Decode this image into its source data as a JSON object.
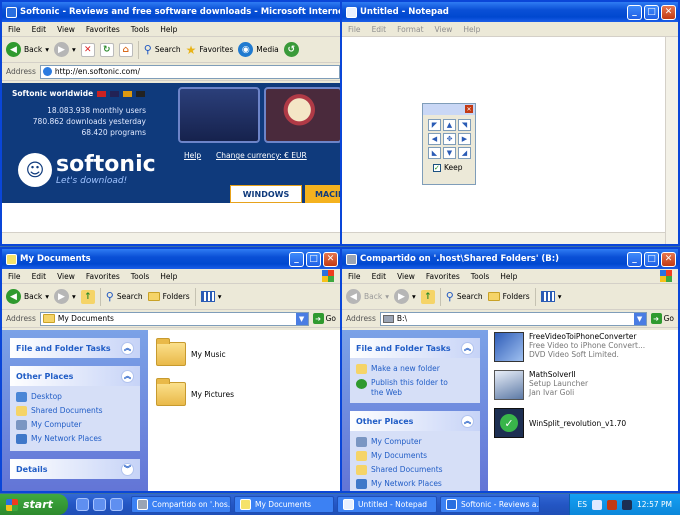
{
  "ie": {
    "title": "Softonic - Reviews and free software downloads - Microsoft Internet Explorer",
    "menu": [
      "File",
      "Edit",
      "View",
      "Favorites",
      "Tools",
      "Help"
    ],
    "toolbar": {
      "back": "Back",
      "search": "Search",
      "favorites": "Favorites",
      "media": "Media"
    },
    "address_label": "Address",
    "address_value": "http://en.softonic.com/",
    "worldwide": "Softonic worldwide",
    "stats": [
      "18.083.938 monthly users",
      "780.862 downloads yesterday",
      "68.420 programs"
    ],
    "logo_text": "softonic",
    "tagline": "Let's download!",
    "help_link": "Help",
    "currency_link": "Change currency: € EUR",
    "tabs": [
      "WINDOWS",
      "MACIN"
    ]
  },
  "notepad": {
    "title": "Untitled - Notepad",
    "menu": [
      "File",
      "Edit",
      "Format",
      "View",
      "Help"
    ],
    "keep_label": "Keep"
  },
  "mydocs": {
    "title": "My Documents",
    "menu": [
      "File",
      "Edit",
      "View",
      "Favorites",
      "Tools",
      "Help"
    ],
    "toolbar": {
      "back": "Back",
      "search": "Search",
      "folders": "Folders"
    },
    "address_label": "Address",
    "address_value": "My Documents",
    "go": "Go",
    "tasks_header": "File and Folder Tasks",
    "other_header": "Other Places",
    "other_items": [
      "Desktop",
      "Shared Documents",
      "My Computer",
      "My Network Places"
    ],
    "details_header": "Details",
    "files": [
      "My Music",
      "My Pictures"
    ]
  },
  "shared": {
    "title": "Compartido on '.host\\Shared Folders' (B:)",
    "menu": [
      "File",
      "Edit",
      "View",
      "Favorites",
      "Tools",
      "Help"
    ],
    "toolbar": {
      "back": "Back",
      "search": "Search",
      "folders": "Folders"
    },
    "address_label": "Address",
    "address_value": "B:\\",
    "go": "Go",
    "tasks_header": "File and Folder Tasks",
    "tasks_items": [
      "Make a new folder",
      "Publish this folder to the Web"
    ],
    "other_header": "Other Places",
    "other_items": [
      "My Computer",
      "My Documents",
      "Shared Documents",
      "My Network Places"
    ],
    "files": [
      {
        "name": "FreeVideoToiPhoneConverter",
        "line2": "Free Video to iPhone Convert...",
        "line3": "DVD Video Soft Limited."
      },
      {
        "name": "MathSolverII",
        "line2": "Setup Launcher",
        "line3": "Jan Ivar Goli"
      },
      {
        "name": "WinSplit_revolution_v1.70",
        "line2": "",
        "line3": ""
      }
    ]
  },
  "taskbar": {
    "start": "start",
    "tasks": [
      "Compartido on '.hos...",
      "My Documents",
      "Untitled - Notepad",
      "Softonic - Reviews a..."
    ],
    "lang": "ES",
    "clock": "12:57 PM"
  },
  "colors": {
    "titlebar": "#0a50d6",
    "taskpane": "#6375d6",
    "softonic_blue": "#0f3a7c"
  }
}
